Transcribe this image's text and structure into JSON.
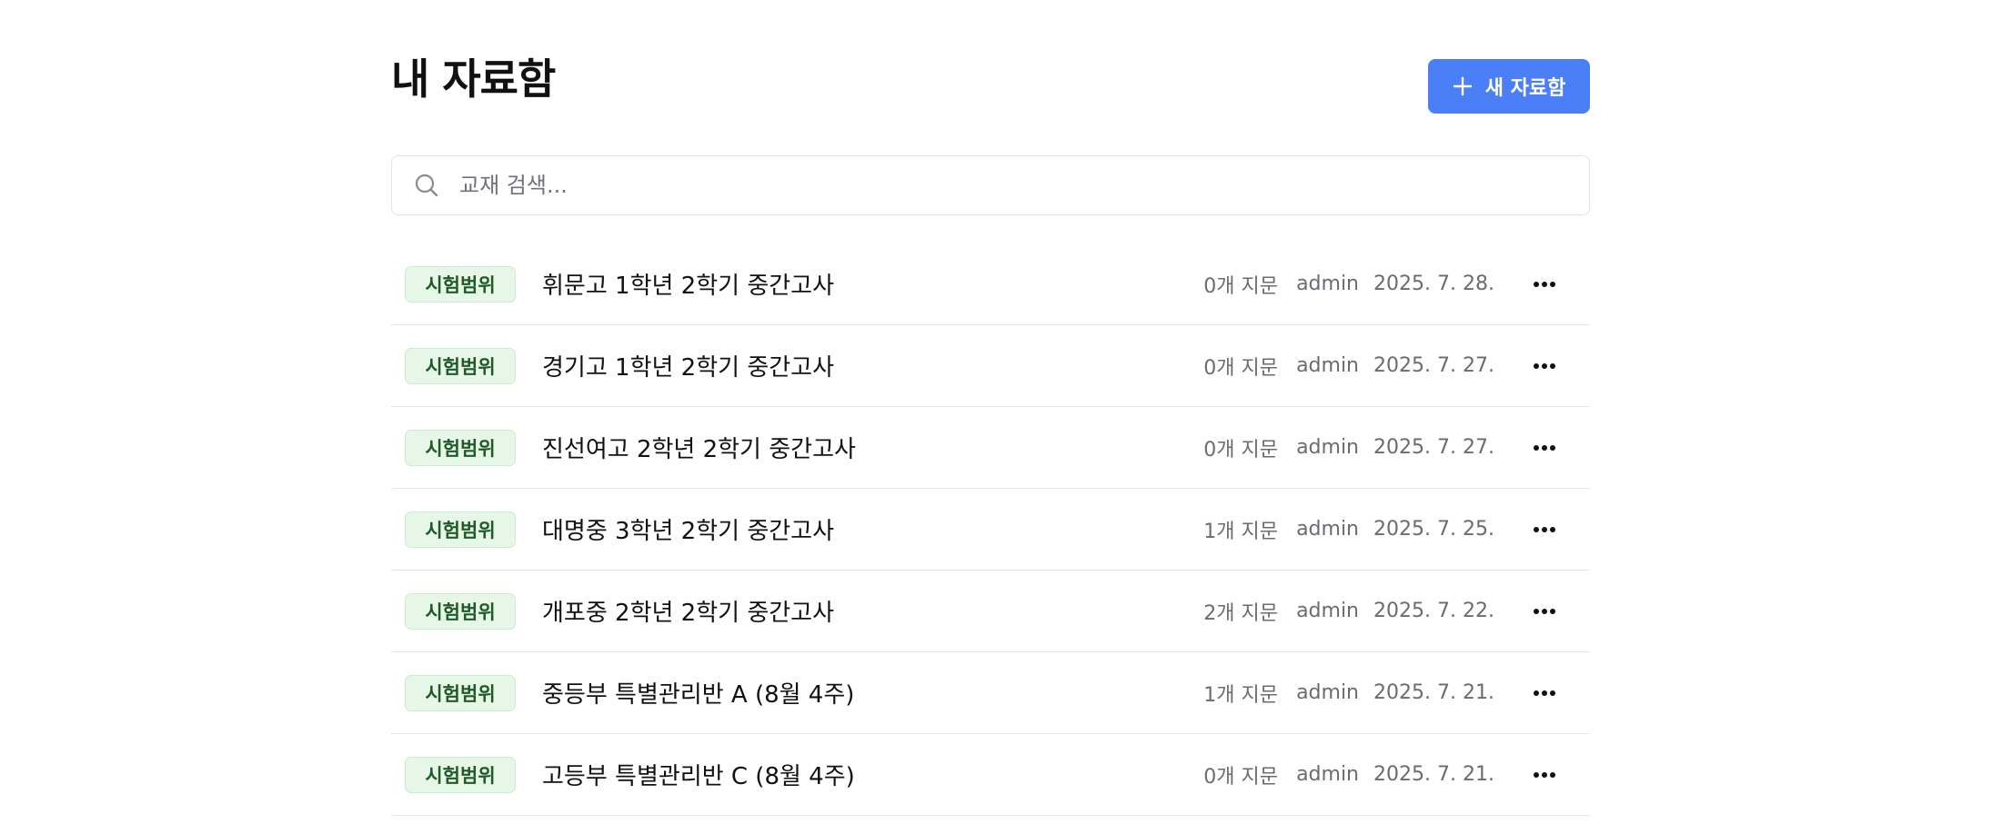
{
  "page": {
    "title": "내 자료함",
    "new_button_label": "새 자료함"
  },
  "search": {
    "placeholder": "교재 검색...",
    "value": ""
  },
  "items": [
    {
      "badge": "시험범위",
      "title": "휘문고 1학년 2학기 중간고사",
      "count": "0개 지문",
      "author": "admin",
      "date": "2025. 7. 28."
    },
    {
      "badge": "시험범위",
      "title": "경기고 1학년 2학기 중간고사",
      "count": "0개 지문",
      "author": "admin",
      "date": "2025. 7. 27."
    },
    {
      "badge": "시험범위",
      "title": "진선여고 2학년 2학기 중간고사",
      "count": "0개 지문",
      "author": "admin",
      "date": "2025. 7. 27."
    },
    {
      "badge": "시험범위",
      "title": "대명중 3학년 2학기 중간고사",
      "count": "1개 지문",
      "author": "admin",
      "date": "2025. 7. 25."
    },
    {
      "badge": "시험범위",
      "title": "개포중 2학년 2학기 중간고사",
      "count": "2개 지문",
      "author": "admin",
      "date": "2025. 7. 22."
    },
    {
      "badge": "시험범위",
      "title": "중등부 특별관리반 A (8월 4주)",
      "count": "1개 지문",
      "author": "admin",
      "date": "2025. 7. 21."
    },
    {
      "badge": "시험범위",
      "title": "고등부 특별관리반 C (8월 4주)",
      "count": "0개 지문",
      "author": "admin",
      "date": "2025. 7. 21."
    }
  ],
  "icons": {
    "plus": "plus-icon",
    "search": "search-icon",
    "more": "more-horizontal-icon"
  },
  "colors": {
    "accent": "#4a7ff7",
    "badge_bg": "#e6f7e8",
    "badge_text": "#1f5a28",
    "muted_text": "#6b6b70"
  }
}
